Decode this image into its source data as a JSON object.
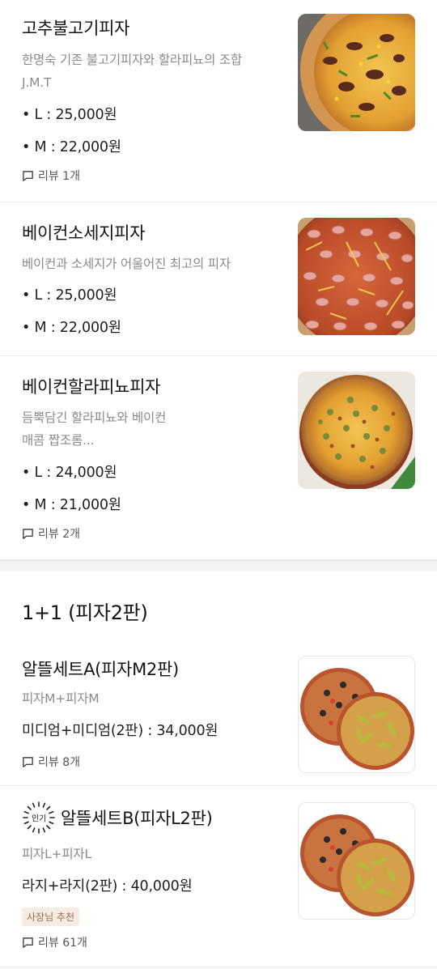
{
  "menu_items": [
    {
      "name": "고추불고기피자",
      "description_lines": [
        "한명숙 기존 불고기피자와 할라피뇨의 조합",
        "J.M.T"
      ],
      "prices": [
        "• L : 25,000원",
        "• M : 22,000원"
      ],
      "review": "리뷰 1개"
    },
    {
      "name": "베이컨소세지피자",
      "description_lines": [
        "베이컨과 소세지가 어울어진 최고의 피자"
      ],
      "prices": [
        "• L : 25,000원",
        "• M : 22,000원"
      ],
      "review": ""
    },
    {
      "name": "베이컨할라피뇨피자",
      "description_lines": [
        "듬뿍담긴 할라피뇨와 베이컨",
        "매콤 짭조롬..."
      ],
      "prices": [
        "• L : 24,000원",
        "• M : 21,000원"
      ],
      "review": "리뷰 2개"
    }
  ],
  "section": {
    "title": "1+1 (피자2판)"
  },
  "set_items": [
    {
      "name": "알뜰세트A(피자M2판)",
      "description": "피자M+피자M",
      "price": "미디엄+미디엄(2판) : 34,000원",
      "review": "리뷰 8개"
    },
    {
      "popular_badge": "인기",
      "name": "알뜰세트B(피자L2판)",
      "description": "피자L+피자L",
      "price": "라지+라지(2판) : 40,000원",
      "tag": "사장님 추천",
      "review": "리뷰 61개"
    }
  ],
  "icons": {
    "review": "speech-bubble-icon",
    "popular": "sunburst-badge-icon"
  },
  "colors": {
    "tag_bg": "#f6ece4",
    "tag_text": "#9a6a4f",
    "section_gap": "#f2f3f5"
  }
}
